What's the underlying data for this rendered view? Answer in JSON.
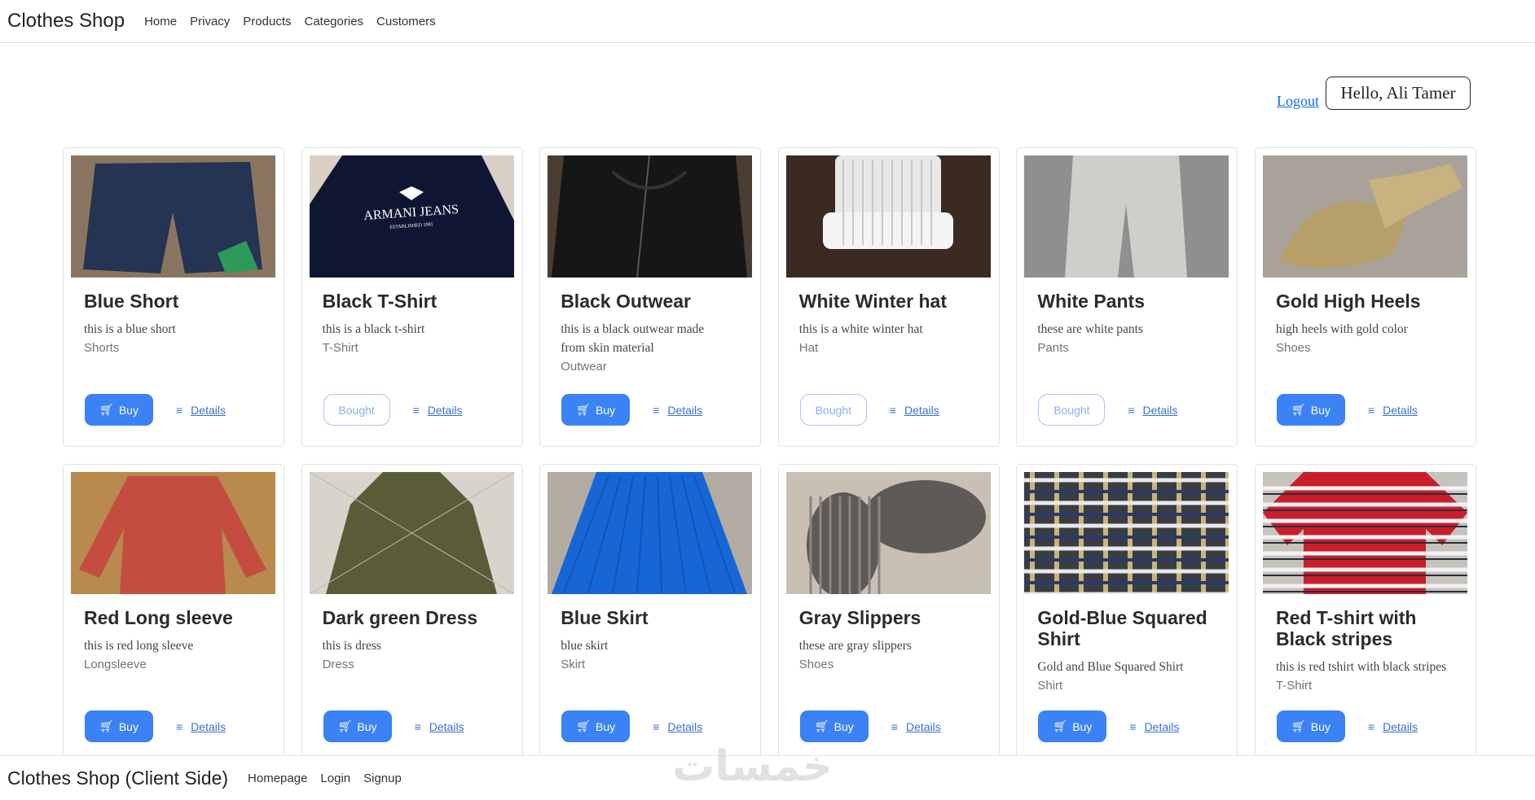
{
  "nav": {
    "brand": "Clothes Shop",
    "links": [
      "Home",
      "Privacy",
      "Products",
      "Categories",
      "Customers"
    ]
  },
  "user": {
    "logout": "Logout",
    "greeting": "Hello, Ali Tamer"
  },
  "buttons": {
    "buy": "Buy",
    "bought": "Bought",
    "details": "Details"
  },
  "products": [
    {
      "title": "Blue Short",
      "desc": "this is a blue short",
      "category": "Shorts",
      "status": "buy"
    },
    {
      "title": "Black T-Shirt",
      "desc": "this is a black t-shirt",
      "category": "T-Shirt",
      "status": "bought"
    },
    {
      "title": "Black Outwear",
      "desc": "this is a black outwear made from skin material",
      "category": "Outwear",
      "status": "buy"
    },
    {
      "title": "White Winter hat",
      "desc": "this is a white winter hat",
      "category": "Hat",
      "status": "bought"
    },
    {
      "title": "White Pants",
      "desc": "these are white pants",
      "category": "Pants",
      "status": "bought"
    },
    {
      "title": "Gold High Heels",
      "desc": "high heels with gold color",
      "category": "Shoes",
      "status": "buy"
    },
    {
      "title": "Red Long sleeve",
      "desc": "this is red long sleeve",
      "category": "Longsleeve",
      "status": "buy"
    },
    {
      "title": "Dark green Dress",
      "desc": "this is dress",
      "category": "Dress",
      "status": "buy"
    },
    {
      "title": "Blue Skirt",
      "desc": "blue skirt",
      "category": "Skirt",
      "status": "buy"
    },
    {
      "title": "Gray Slippers",
      "desc": "these are gray slippers",
      "category": "Shoes",
      "status": "buy"
    },
    {
      "title": "Gold-Blue Squared Shirt",
      "desc": "Gold and Blue Squared Shirt",
      "category": "Shirt",
      "status": "buy"
    },
    {
      "title": "Red T-shirt with Black stripes",
      "desc": "this is red tshirt with black stripes",
      "category": "T-Shirt",
      "status": "buy"
    }
  ],
  "images": [
    {
      "bg": "#8a7660",
      "fg": "#243452",
      "shape": "shorts"
    },
    {
      "bg": "#d9cfc5",
      "fg": "#0f1633",
      "shape": "tshirt-logo",
      "logo": "ARMANI JEANS",
      "logo_sub": "ESTABLISHED 1981"
    },
    {
      "bg": "#4a3e33",
      "fg": "#161616",
      "shape": "jacket"
    },
    {
      "bg": "#3a2a22",
      "fg": "#e8e8e8",
      "shape": "hat"
    },
    {
      "bg": "#8f8f8f",
      "fg": "#cfcfca",
      "shape": "pants"
    },
    {
      "bg": "#a8a29a",
      "fg": "#b79f6a",
      "shape": "heels"
    },
    {
      "bg": "#b88a4e",
      "fg": "#c44d40",
      "shape": "longsleeve"
    },
    {
      "bg": "#d8d3cc",
      "fg": "#5a5c38",
      "shape": "dress"
    },
    {
      "bg": "#b2aba2",
      "fg": "#1766d6",
      "shape": "skirt"
    },
    {
      "bg": "#c9bfb3",
      "fg": "#5d5a57",
      "shape": "slippers"
    },
    {
      "bg": "#3a3c44",
      "fg": "#c9b47a",
      "shape": "plaid"
    },
    {
      "bg": "#c6c2bd",
      "fg": "#c91e2b",
      "shape": "stripes"
    }
  ],
  "footer": {
    "brand": "Clothes Shop (Client Side)",
    "links": [
      "Homepage",
      "Login",
      "Signup"
    ],
    "watermark": "خمسات"
  }
}
